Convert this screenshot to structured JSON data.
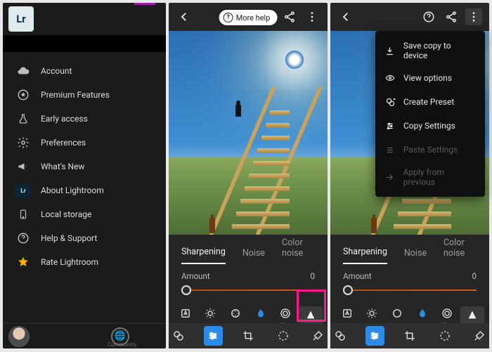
{
  "sidebar": {
    "logo_text": "Lr",
    "items": [
      {
        "label": "Account",
        "icon": "cloud-icon"
      },
      {
        "label": "Premium Features",
        "icon": "star-outline-icon"
      },
      {
        "label": "Early access",
        "icon": "flask-icon"
      },
      {
        "label": "Preferences",
        "icon": "gear-icon"
      },
      {
        "label": "What's New",
        "icon": "megaphone-icon"
      },
      {
        "label": "About Lightroom",
        "icon": "lr-badge-icon"
      },
      {
        "label": "Local storage",
        "icon": "phone-icon"
      },
      {
        "label": "Help & Support",
        "icon": "help-icon"
      },
      {
        "label": "Rate Lightroom",
        "icon": "star-filled-icon",
        "accent": "#f5b400"
      }
    ],
    "bottom_label": "Community"
  },
  "help_chip": {
    "label": "More help"
  },
  "detail_panel": {
    "subtabs": [
      "Sharpening",
      "Noise",
      "Color noise"
    ],
    "active_subtab": "Sharpening",
    "amount_label": "Amount",
    "amount_value": "0",
    "tools": [
      {
        "label": "Auto",
        "icon": "auto-icon"
      },
      {
        "label": "Light",
        "icon": "light-icon"
      },
      {
        "label": "Color",
        "icon": "color-icon"
      },
      {
        "label": "Blur",
        "icon": "blur-icon",
        "accent": "#2d8be8"
      },
      {
        "label": "Effects",
        "icon": "effects-icon"
      },
      {
        "label": "Detail",
        "icon": "detail-icon",
        "selected": true
      }
    ]
  },
  "overflow_menu": {
    "items": [
      {
        "label": "Save copy to device",
        "icon": "download-icon",
        "enabled": true
      },
      {
        "label": "View options",
        "icon": "eye-gear-icon",
        "enabled": true
      },
      {
        "label": "Create Preset",
        "icon": "preset-add-icon",
        "enabled": true
      },
      {
        "label": "Copy Settings",
        "icon": "copy-sliders-icon",
        "enabled": true
      },
      {
        "label": "Paste Settings",
        "icon": "paste-sliders-icon",
        "enabled": false
      },
      {
        "label": "Apply from previous",
        "icon": "apply-prev-icon",
        "enabled": false
      }
    ]
  },
  "topbar_icons": {
    "back": "back-icon",
    "help": "help-icon",
    "share": "share-icon",
    "more": "more-icon"
  }
}
